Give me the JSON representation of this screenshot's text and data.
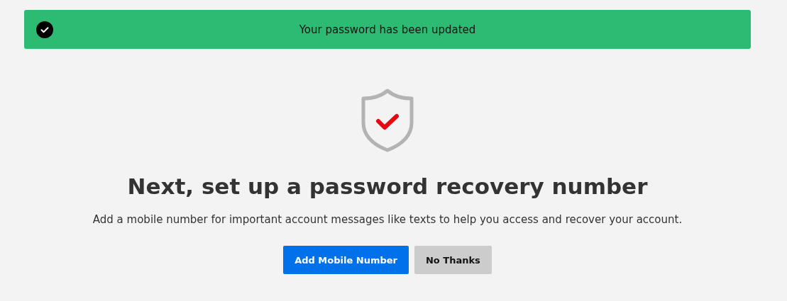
{
  "banner": {
    "message": "Your password has been updated"
  },
  "heading": "Next, set up a password recovery number",
  "description": "Add a mobile number for important account messages like texts to help you access and recover your account.",
  "buttons": [
    {
      "label": "Add Mobile Number",
      "kind": "primary"
    },
    {
      "label": "No Thanks",
      "kind": "secondary"
    }
  ]
}
